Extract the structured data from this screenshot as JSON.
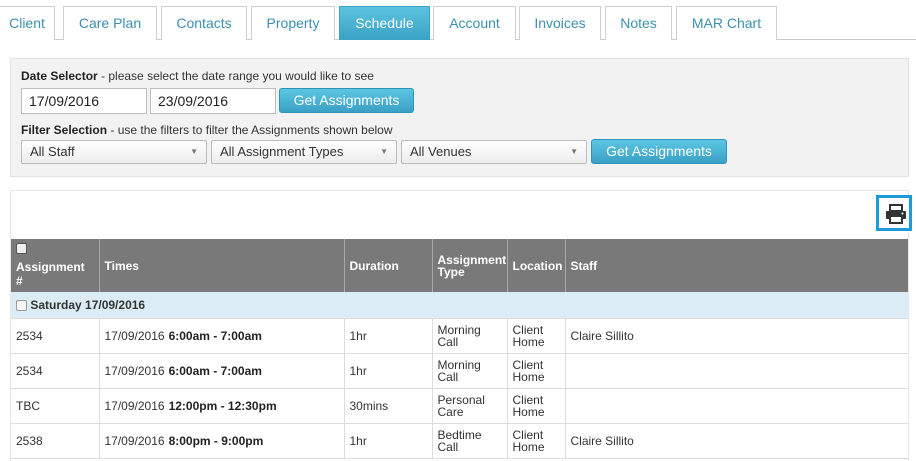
{
  "tabs": [
    {
      "label": "Client",
      "active": false
    },
    {
      "label": "Care Plan",
      "active": false
    },
    {
      "label": "Contacts",
      "active": false
    },
    {
      "label": "Property",
      "active": false
    },
    {
      "label": "Schedule",
      "active": true
    },
    {
      "label": "Account",
      "active": false
    },
    {
      "label": "Invoices",
      "active": false
    },
    {
      "label": "Notes",
      "active": false
    },
    {
      "label": "MAR Chart",
      "active": false
    }
  ],
  "date_selector": {
    "label": "Date Selector",
    "hint": " - please select the date range you would like to see",
    "start_date": "17/09/2016",
    "end_date": "23/09/2016",
    "button": "Get Assignments"
  },
  "filter_selection": {
    "label": "Filter Selection",
    "hint": " - use the filters to filter the Assignments shown below",
    "staff": "All Staff",
    "types": "All Assignment Types",
    "venues": "All Venues",
    "button": "Get Assignments"
  },
  "print": {
    "icon": "printer-icon"
  },
  "table": {
    "headers": {
      "assignment": "Assignment #",
      "times": "Times",
      "duration": "Duration",
      "type": "Assignment Type",
      "location": "Location",
      "staff": "Staff"
    },
    "group_label": "Saturday 17/09/2016",
    "rows": [
      {
        "id": "2534",
        "date": "17/09/2016",
        "time": "6:00am - 7:00am",
        "duration": "1hr",
        "type": "Morning Call",
        "location": "Client Home",
        "staff": "Claire Sillito"
      },
      {
        "id": "2534",
        "date": "17/09/2016",
        "time": "6:00am - 7:00am",
        "duration": "1hr",
        "type": "Morning Call",
        "location": "Client Home",
        "staff": ""
      },
      {
        "id": "TBC",
        "date": "17/09/2016",
        "time": "12:00pm - 12:30pm",
        "duration": "30mins",
        "type": "Personal Care",
        "location": "Client Home",
        "staff": ""
      },
      {
        "id": "2538",
        "date": "17/09/2016",
        "time": "8:00pm - 9:00pm",
        "duration": "1hr",
        "type": "Bedtime Call",
        "location": "Client Home",
        "staff": "Claire Sillito"
      }
    ]
  },
  "colors": {
    "accent": "#3aa2c6",
    "header_bg": "#797979",
    "group_bg": "#dbecf4",
    "focus_border": "#1d9bd8"
  }
}
